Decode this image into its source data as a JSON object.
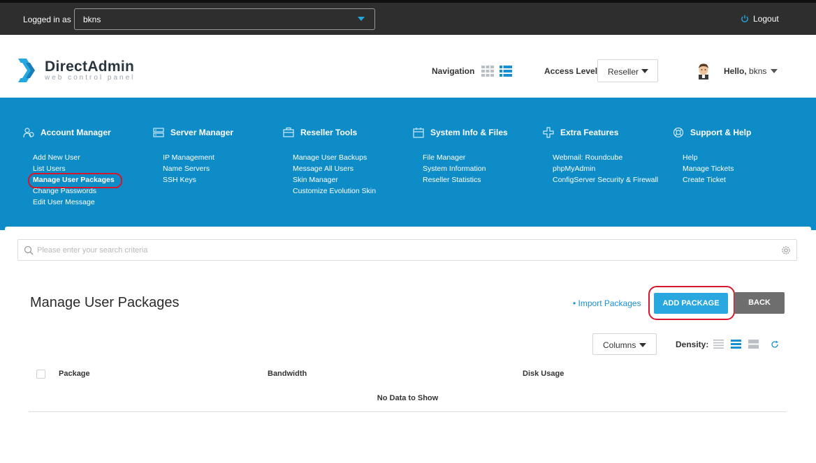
{
  "topbar": {
    "logged_in_label": "Logged in as",
    "user_value": "bkns",
    "logout_label": "Logout"
  },
  "header": {
    "logo_title": "DirectAdmin",
    "logo_subtitle": "web control panel",
    "navigation_label": "Navigation",
    "access_level_label": "Access Level",
    "access_level_value": "Reseller",
    "hello_prefix": "Hello,",
    "hello_user": "bkns"
  },
  "menu": {
    "account_manager": {
      "title": "Account Manager",
      "items": [
        "Add New User",
        "List Users",
        "Manage User Packages",
        "Change Passwords",
        "Edit User Message"
      ]
    },
    "server_manager": {
      "title": "Server Manager",
      "items": [
        "IP Management",
        "Name Servers",
        "SSH Keys"
      ]
    },
    "reseller_tools": {
      "title": "Reseller Tools",
      "items": [
        "Manage User Backups",
        "Message All Users",
        "Skin Manager",
        "Customize Evolution Skin"
      ]
    },
    "system_info": {
      "title": "System Info & Files",
      "items": [
        "File Manager",
        "System Information",
        "Reseller Statistics"
      ]
    },
    "extra_features": {
      "title": "Extra Features",
      "items": [
        "Webmail: Roundcube",
        "phpMyAdmin",
        "ConfigServer Security & Firewall"
      ]
    },
    "support_help": {
      "title": "Support & Help",
      "items": [
        "Help",
        "Manage Tickets",
        "Create Ticket"
      ]
    }
  },
  "search": {
    "placeholder": "Please enter your search criteria",
    "value": ""
  },
  "page": {
    "title": "Manage User Packages",
    "import_link": "• Import Packages",
    "add_button": "ADD PACKAGE",
    "back_button": "BACK"
  },
  "table": {
    "columns_button": "Columns",
    "density_label": "Density:",
    "headers": [
      "Package",
      "Bandwidth",
      "Disk Usage"
    ],
    "empty_message": "No Data to Show"
  },
  "colors": {
    "accent": "#0e8cc8",
    "button_blue": "#29a8e0",
    "topbar": "#2e2e2e",
    "highlight": "#d6162c"
  }
}
